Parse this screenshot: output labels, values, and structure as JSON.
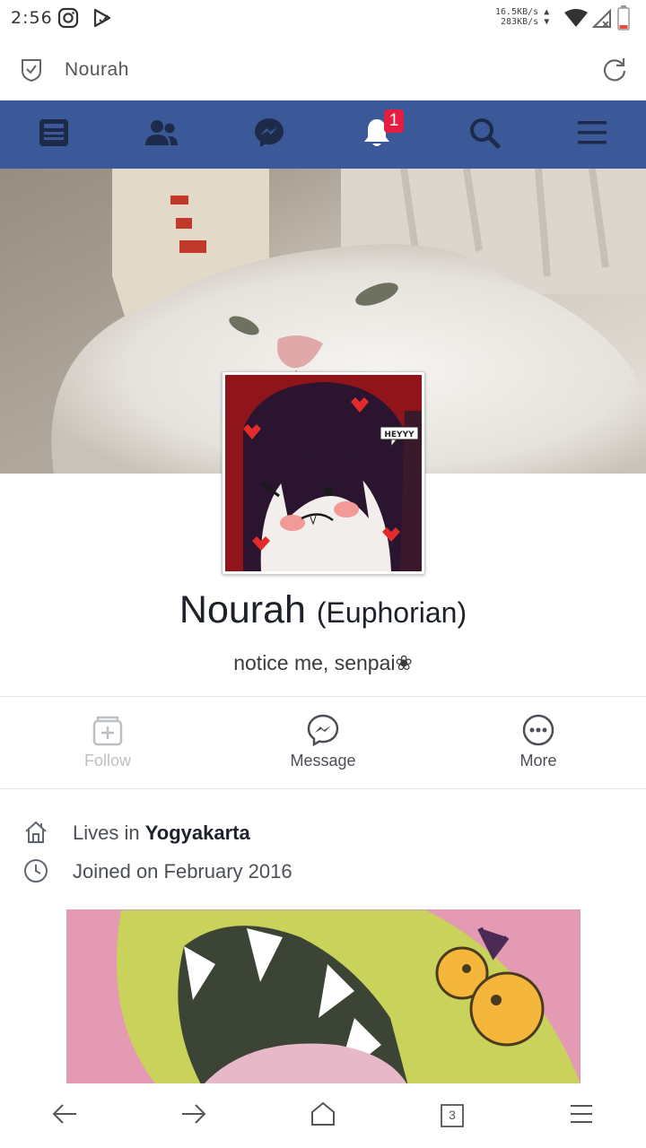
{
  "status_bar": {
    "time": "2:56",
    "net_up": "16.5KB/s",
    "net_down": "283KB/s"
  },
  "browser": {
    "url_title": "Nourah"
  },
  "nav": {
    "items": [
      {
        "icon": "news-feed-icon"
      },
      {
        "icon": "friends-icon"
      },
      {
        "icon": "messenger-icon"
      },
      {
        "icon": "notifications-icon",
        "badge": "1"
      },
      {
        "icon": "search-icon"
      },
      {
        "icon": "menu-icon"
      }
    ]
  },
  "profile": {
    "name": "Nourah",
    "alternate_name": "(Euphorian)",
    "bio": "notice me, senpai❀",
    "avatar_caption": "HEYYY"
  },
  "actions": {
    "follow": "Follow",
    "message": "Message",
    "more": "More"
  },
  "about": {
    "lives_prefix": "Lives in",
    "lives_city": "Yogyakarta",
    "joined": "Joined on February 2016"
  },
  "bottom_nav": {
    "tabs_count": "3"
  },
  "colors": {
    "fb_blue": "#3b5998",
    "badge_red": "#e41e3f"
  }
}
